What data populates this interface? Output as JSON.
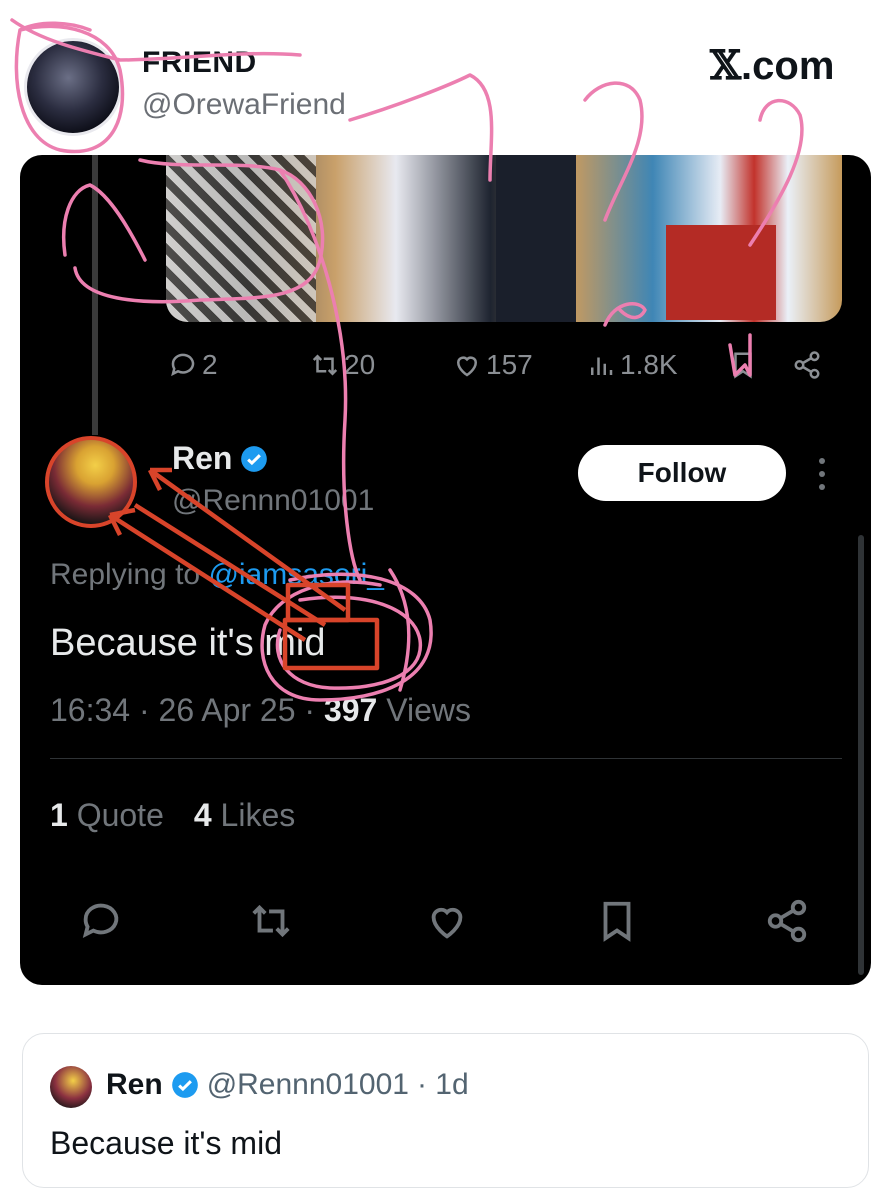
{
  "header": {
    "name": "FRIEND",
    "handle": "@OrewaFriend",
    "site": ".com",
    "site_logo": "𝕏"
  },
  "quoted_post": {
    "stats": {
      "replies": "2",
      "reposts": "20",
      "likes": "157",
      "views": "1.8K"
    }
  },
  "reply_post": {
    "name": "Ren",
    "handle": "@Rennn01001",
    "follow_label": "Follow",
    "replying_prefix": "Replying to ",
    "replying_handle": "@iamsasori_",
    "text": "Because it's mid",
    "time": "16:34 · 26 Apr 25 · ",
    "views_count": "397",
    "views_label": " Views",
    "quotes_count": "1",
    "quotes_label": "Quote",
    "likes_count": "4",
    "likes_label": "Likes"
  },
  "quote_card": {
    "name": "Ren",
    "handle": "@Rennn01001",
    "age": "· 1d",
    "text": "Because it's mid"
  },
  "colors": {
    "verified": "#1d9bf0",
    "annotation_pink": "#ec7fb0",
    "annotation_red": "#d8442a"
  }
}
